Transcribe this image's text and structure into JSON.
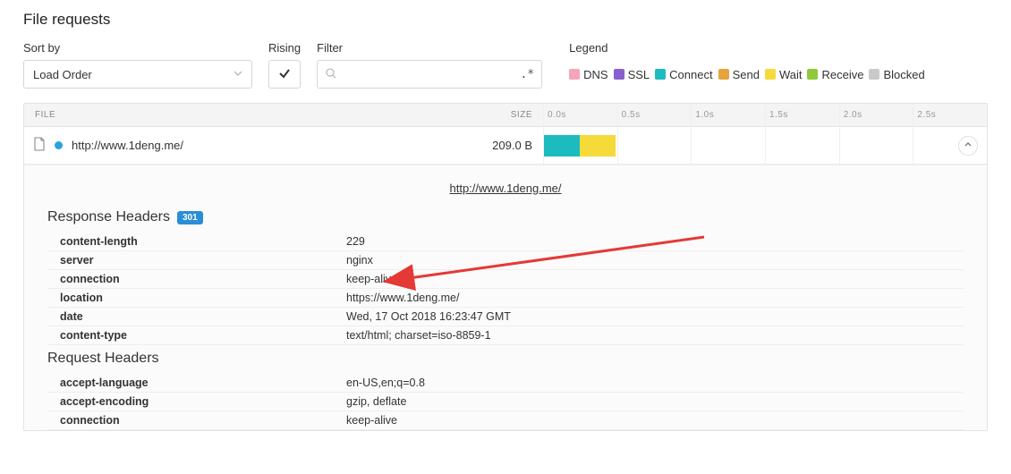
{
  "title": "File requests",
  "controls": {
    "sort_label": "Sort by",
    "sort_value": "Load Order",
    "rising_label": "Rising",
    "filter_label": "Filter",
    "filter_placeholder": "",
    "regex_hint": ".*",
    "legend_label": "Legend"
  },
  "legend": [
    {
      "name": "DNS",
      "color": "#f3a5b9"
    },
    {
      "name": "SSL",
      "color": "#8a5fd0"
    },
    {
      "name": "Connect",
      "color": "#1bbbc0"
    },
    {
      "name": "Send",
      "color": "#e6a33e"
    },
    {
      "name": "Wait",
      "color": "#f5da3a"
    },
    {
      "name": "Receive",
      "color": "#8fc93a"
    },
    {
      "name": "Blocked",
      "color": "#c9c9c9"
    }
  ],
  "table": {
    "columns": {
      "file": "FILE",
      "size": "SIZE"
    },
    "ticks": [
      "0.0s",
      "0.5s",
      "1.0s",
      "1.5s",
      "2.0s",
      "2.5s"
    ],
    "rows": [
      {
        "url": "http://www.1deng.me/",
        "size": "209.0 B",
        "bars": {
          "connect_width": 40,
          "wait_width": 40
        }
      }
    ]
  },
  "detail": {
    "url": "http://www.1deng.me/",
    "status_badge": "301",
    "response_title": "Response Headers",
    "request_title": "Request Headers",
    "response_headers": [
      {
        "k": "content-length",
        "v": "229"
      },
      {
        "k": "server",
        "v": "nginx"
      },
      {
        "k": "connection",
        "v": "keep-alive"
      },
      {
        "k": "location",
        "v": "https://www.1deng.me/"
      },
      {
        "k": "date",
        "v": "Wed, 17 Oct 2018 16:23:47 GMT"
      },
      {
        "k": "content-type",
        "v": "text/html; charset=iso-8859-1"
      }
    ],
    "request_headers": [
      {
        "k": "accept-language",
        "v": "en-US,en;q=0.8"
      },
      {
        "k": "accept-encoding",
        "v": "gzip, deflate"
      },
      {
        "k": "connection",
        "v": "keep-alive"
      }
    ]
  }
}
